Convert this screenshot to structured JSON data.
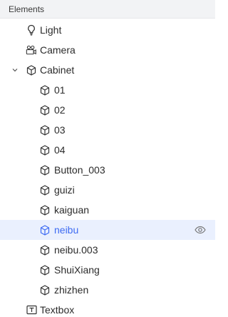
{
  "panel": {
    "title": "Elements"
  },
  "tree": {
    "light": {
      "label": "Light",
      "icon": "lightbulb-icon"
    },
    "camera": {
      "label": "Camera",
      "icon": "camera-icon"
    },
    "cabinet": {
      "label": "Cabinet",
      "icon": "cube-icon",
      "expanded": true,
      "children": [
        {
          "label": "01",
          "icon": "cube-icon"
        },
        {
          "label": "02",
          "icon": "cube-icon"
        },
        {
          "label": "03",
          "icon": "cube-icon"
        },
        {
          "label": "04",
          "icon": "cube-icon"
        },
        {
          "label": "Button_003",
          "icon": "cube-icon"
        },
        {
          "label": "guizi",
          "icon": "cube-icon"
        },
        {
          "label": "kaiguan",
          "icon": "cube-icon"
        },
        {
          "label": "neibu",
          "icon": "cube-icon",
          "selected": true,
          "visibility_icon": "eye-icon"
        },
        {
          "label": "neibu.003",
          "icon": "cube-icon"
        },
        {
          "label": "ShuiXiang",
          "icon": "cube-icon"
        },
        {
          "label": "zhizhen",
          "icon": "cube-icon"
        }
      ]
    },
    "textbox": {
      "label": "Textbox",
      "icon": "text-box-icon"
    }
  },
  "colors": {
    "accent": "#3e6bf2",
    "selected_bg": "#eaf0fe",
    "header_bg": "#f2f3f5"
  }
}
